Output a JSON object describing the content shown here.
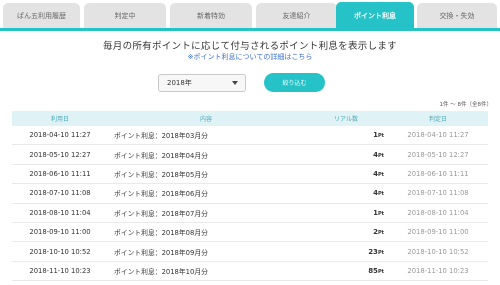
{
  "tabs": [
    {
      "label": "ぱん五利用履歴",
      "active": false
    },
    {
      "label": "判定中",
      "active": false
    },
    {
      "label": "新着特効",
      "active": false
    },
    {
      "label": "友達紹介",
      "active": false
    },
    {
      "label": "ポイント利息",
      "active": true
    },
    {
      "label": "交換・失効",
      "active": false
    }
  ],
  "heading": "毎月の所有ポイントに応じて付与されるポイント利息を表示します",
  "sublink": "※ポイント利息についての詳細はこちら",
  "filter": {
    "year_selected": "2018年",
    "button_label": "絞り込む"
  },
  "result_count": "1件 〜 8件（全8件）",
  "table": {
    "headers": {
      "date": "利用日",
      "content": "内容",
      "real": "リアル数",
      "judge": "判定日"
    },
    "unit": "Pt",
    "rows": [
      {
        "date": "2018-04-10 11:27",
        "content": "ポイント利息：2018年03月分",
        "amount": "1",
        "judge": "2018-04-10 11:27"
      },
      {
        "date": "2018-05-10 12:27",
        "content": "ポイント利息：2018年04月分",
        "amount": "4",
        "judge": "2018-05-10 12:27"
      },
      {
        "date": "2018-06-10 11:11",
        "content": "ポイント利息：2018年05月分",
        "amount": "4",
        "judge": "2018-06-10 11:11"
      },
      {
        "date": "2018-07-10 11:08",
        "content": "ポイント利息：2018年06月分",
        "amount": "4",
        "judge": "2018-07-10 11:08"
      },
      {
        "date": "2018-08-10 11:04",
        "content": "ポイント利息：2018年07月分",
        "amount": "1",
        "judge": "2018-08-10 11:04"
      },
      {
        "date": "2018-09-10 11:00",
        "content": "ポイント利息：2018年08月分",
        "amount": "2",
        "judge": "2018-09-10 11:00"
      },
      {
        "date": "2018-10-10 10:52",
        "content": "ポイント利息：2018年09月分",
        "amount": "23",
        "judge": "2018-10-10 10:52"
      },
      {
        "date": "2018-11-10 10:23",
        "content": "ポイント利息：2018年10月分",
        "amount": "85",
        "judge": "2018-11-10 10:23"
      }
    ]
  },
  "colors": {
    "accent": "#25c3c8",
    "header_bg": "#dff2f5",
    "link": "#3a6fd8"
  }
}
